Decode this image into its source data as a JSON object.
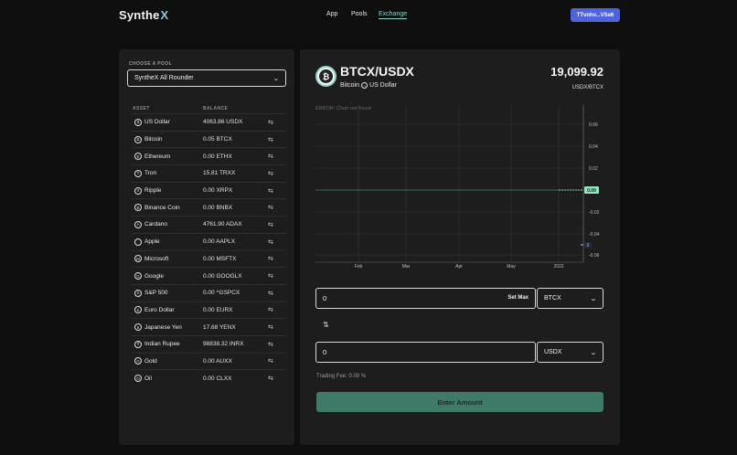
{
  "header": {
    "logo_text": "Synthe",
    "logo_mark": "X",
    "nav": [
      {
        "label": "App"
      },
      {
        "label": "Pools"
      },
      {
        "label": "Exchange",
        "active": true
      }
    ],
    "wallet_label": "TTvnhv...VSe6"
  },
  "pool": {
    "label": "CHOOSE A POOL",
    "selected": "SyntheX All Rounder"
  },
  "table": {
    "col_asset": "ASSET",
    "col_balance": "BALANCE",
    "rows": [
      {
        "icon": "$",
        "name": "US Dollar",
        "balance": "4063.86 USDX"
      },
      {
        "icon": "B",
        "name": "Bitcoin",
        "balance": "0.05 BTCX"
      },
      {
        "icon": "E",
        "name": "Ethereum",
        "balance": "0.00 ETHX"
      },
      {
        "icon": "T",
        "name": "Tron",
        "balance": "15.81 TRXX"
      },
      {
        "icon": "X",
        "name": "Ripple",
        "balance": "0.00 XRPX"
      },
      {
        "icon": "B",
        "name": "Binance Coin",
        "balance": "0.00 BNBX"
      },
      {
        "icon": "A",
        "name": "Cardano",
        "balance": "4761.90 ADAX"
      },
      {
        "icon": "",
        "name": "Apple",
        "balance": "0.00 AAPLX"
      },
      {
        "icon": "M",
        "name": "Microsoft",
        "balance": "0.00 MSFTX"
      },
      {
        "icon": "G",
        "name": "Google",
        "balance": "0.00 GOOGLX"
      },
      {
        "icon": "S",
        "name": "S&P 500",
        "balance": "0.00 ^GSPCX"
      },
      {
        "icon": "€",
        "name": "Euro Dollar",
        "balance": "0.00 EURX"
      },
      {
        "icon": "¥",
        "name": "Japanese Yen",
        "balance": "17.68 YENX"
      },
      {
        "icon": "₹",
        "name": "Indian Rupee",
        "balance": "98838.32 INRX"
      },
      {
        "icon": "G",
        "name": "Gold",
        "balance": "0.00 AUXX"
      },
      {
        "icon": "O",
        "name": "Oil",
        "balance": "0.00 CLXX"
      }
    ],
    "swap_glyph": "⇆"
  },
  "pair": {
    "title": "BTCX/USDX",
    "from_name": "Bitcoin",
    "to_name": "US Dollar",
    "price": "19,099.92",
    "price_unit": "USDX/BTCX"
  },
  "chart": {
    "error": "ERROR: Chart not found",
    "x_ticks": [
      "Feb",
      "Mar",
      "Apr",
      "May",
      "2022"
    ],
    "y_ticks": [
      "0.06",
      "0.04",
      "0.02",
      "0.00",
      "-0.02",
      "-0.04",
      "-0.06"
    ],
    "current_label": "0.00",
    "marker_label": "0"
  },
  "exchange": {
    "from_value": "0",
    "set_max": "Set Max",
    "from_token": "BTCX",
    "to_value": "0",
    "to_token": "USDX",
    "fee": "Trading Fee: 0.00 %",
    "submit": "Enter Amount"
  },
  "colors": {
    "accent": "#8fd3c7",
    "wallet": "#4f63e0",
    "button": "#3f7a68",
    "panel": "#1d1d1d",
    "background": "#0f0f0f"
  }
}
